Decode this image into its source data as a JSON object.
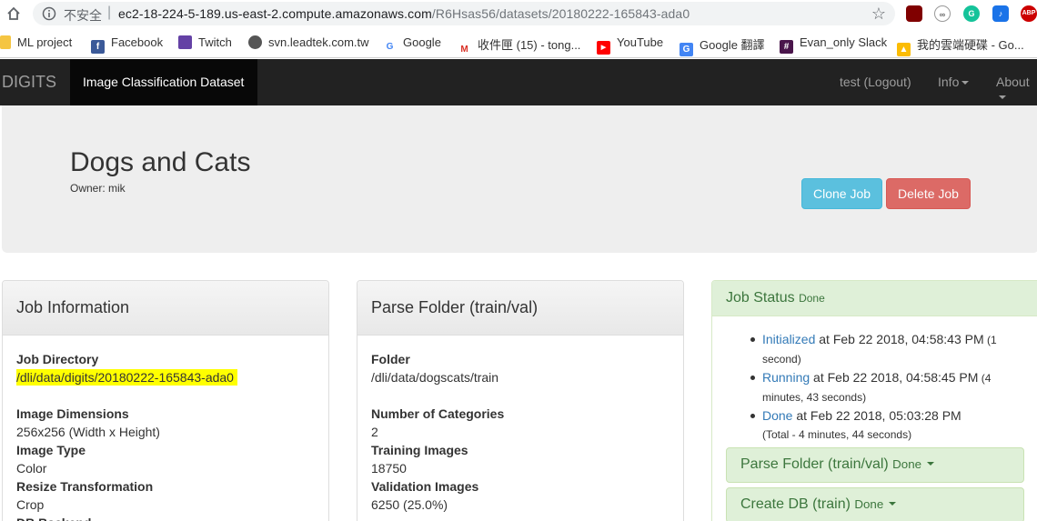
{
  "browser": {
    "insecure_label": "不安全",
    "separator": "|",
    "url_host": "ec2-18-224-5-189.us-east-2.compute.amazonaws.com",
    "url_path": "/R6Hsas56/datasets/20180222-165843-ada0",
    "extensions": [
      "uBlock",
      "ABP"
    ],
    "bookmarks": [
      {
        "label": "ML project"
      },
      {
        "label": "Facebook"
      },
      {
        "label": "Twitch"
      },
      {
        "label": "svn.leadtek.com.tw"
      },
      {
        "label": "Google"
      },
      {
        "label": "收件匣 (15) - tong..."
      },
      {
        "label": "YouTube"
      },
      {
        "label": "Google 翻譯"
      },
      {
        "label": "Evan_only Slack"
      },
      {
        "label": "我的雲端硬碟 - Go..."
      }
    ]
  },
  "navbar": {
    "brand": "DIGITS",
    "active": "Image Classification Dataset",
    "user": "test (Logout)",
    "info": "Info",
    "about": "About"
  },
  "header": {
    "title": "Dogs and Cats",
    "owner": "Owner: mik",
    "clone_label": "Clone Job",
    "delete_label": "Delete Job"
  },
  "job_info": {
    "heading": "Job Information",
    "dir_label": "Job Directory",
    "dir_value": "/dli/data/digits/20180222-165843-ada0",
    "dims_label": "Image Dimensions",
    "dims_value": "256x256 (Width x Height)",
    "type_label": "Image Type",
    "type_value": "Color",
    "resize_label": "Resize Transformation",
    "resize_value": "Crop",
    "backend_label": "DB Backend"
  },
  "parse_folder": {
    "heading": "Parse Folder (train/val)",
    "folder_label": "Folder",
    "folder_value": "/dli/data/dogscats/train",
    "categories_label": "Number of Categories",
    "categories_value": "2",
    "training_label": "Training Images",
    "training_value": "18750",
    "validation_label": "Validation Images",
    "validation_value": "6250 (25.0%)"
  },
  "job_status": {
    "heading": "Job Status",
    "heading_badge": "Done",
    "items": [
      {
        "state": "Initialized",
        "when": " at Feb 22 2018, 04:58:43 PM",
        "dur_a": " (1",
        "dur_b": "second)"
      },
      {
        "state": "Running",
        "when": " at Feb 22 2018, 04:58:45 PM",
        "dur_a": " (4",
        "dur_b": "minutes, 43 seconds)"
      },
      {
        "state": "Done",
        "when": " at Feb 22 2018, 05:03:28 PM",
        "dur_a": "",
        "dur_b": "(Total - 4 minutes, 44 seconds)"
      }
    ],
    "sub_panels": [
      {
        "label": "Parse Folder (train/val)",
        "badge": "Done"
      },
      {
        "label": "Create DB (train)",
        "badge": "Done"
      }
    ]
  }
}
